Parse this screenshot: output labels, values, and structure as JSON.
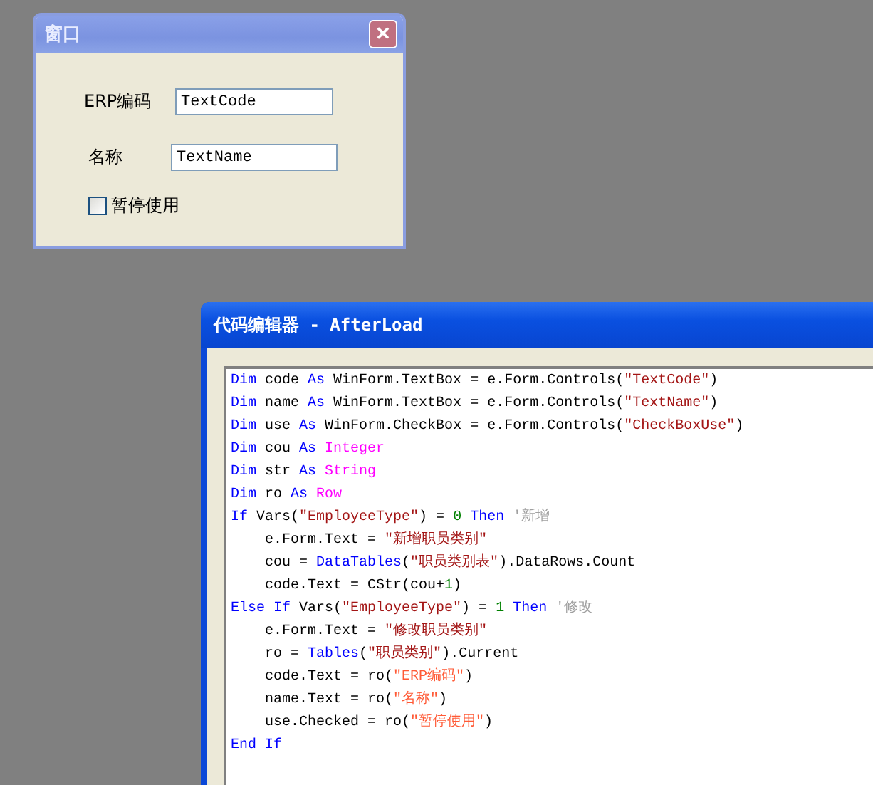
{
  "dialog": {
    "title": "窗口",
    "close": "✕",
    "fields": [
      {
        "label": "ERP编码",
        "value": "TextCode"
      },
      {
        "label": "名称",
        "value": "TextName"
      }
    ],
    "checkbox": {
      "label": "暂停使用",
      "checked": false
    }
  },
  "editor": {
    "title": "代码编辑器 - AfterLoad",
    "lines": [
      {
        "tokens": [
          {
            "kind": "keyword",
            "text": "Dim"
          },
          {
            "kind": "plain",
            "text": " code "
          },
          {
            "kind": "keyword",
            "text": "As"
          },
          {
            "kind": "plain",
            "text": " WinForm.TextBox = e.Form.Controls("
          },
          {
            "kind": "string",
            "text": "\"TextCode\""
          },
          {
            "kind": "plain",
            "text": ")"
          }
        ]
      },
      {
        "tokens": [
          {
            "kind": "keyword",
            "text": "Dim"
          },
          {
            "kind": "plain",
            "text": " name "
          },
          {
            "kind": "keyword",
            "text": "As"
          },
          {
            "kind": "plain",
            "text": " WinForm.TextBox = e.Form.Controls("
          },
          {
            "kind": "string",
            "text": "\"TextName\""
          },
          {
            "kind": "plain",
            "text": ")"
          }
        ]
      },
      {
        "tokens": [
          {
            "kind": "keyword",
            "text": "Dim"
          },
          {
            "kind": "plain",
            "text": " use "
          },
          {
            "kind": "keyword",
            "text": "As"
          },
          {
            "kind": "plain",
            "text": " WinForm.CheckBox = e.Form.Controls("
          },
          {
            "kind": "string",
            "text": "\"CheckBoxUse\""
          },
          {
            "kind": "plain",
            "text": ")"
          }
        ]
      },
      {
        "tokens": [
          {
            "kind": "keyword",
            "text": "Dim"
          },
          {
            "kind": "plain",
            "text": " cou "
          },
          {
            "kind": "keyword",
            "text": "As"
          },
          {
            "kind": "type",
            "text": " Integer"
          }
        ]
      },
      {
        "tokens": [
          {
            "kind": "keyword",
            "text": "Dim"
          },
          {
            "kind": "plain",
            "text": " str "
          },
          {
            "kind": "keyword",
            "text": "As"
          },
          {
            "kind": "type",
            "text": " String"
          }
        ]
      },
      {
        "tokens": [
          {
            "kind": "keyword",
            "text": "Dim"
          },
          {
            "kind": "plain",
            "text": " ro "
          },
          {
            "kind": "keyword",
            "text": "As"
          },
          {
            "kind": "type",
            "text": " Row"
          }
        ]
      },
      {
        "tokens": [
          {
            "kind": "keyword",
            "text": "If"
          },
          {
            "kind": "plain",
            "text": " Vars("
          },
          {
            "kind": "string",
            "text": "\"EmployeeType\""
          },
          {
            "kind": "plain",
            "text": ") = "
          },
          {
            "kind": "number",
            "text": "0"
          },
          {
            "kind": "keyword",
            "text": " Then"
          },
          {
            "kind": "comment",
            "text": " '新增"
          }
        ],
        "children": [
          {
            "tokens": [
              {
                "kind": "plain",
                "text": "e.Form.Text = "
              },
              {
                "kind": "string",
                "text": "\"新增职员类别\""
              }
            ]
          },
          {
            "tokens": [
              {
                "kind": "plain",
                "text": "cou = "
              },
              {
                "kind": "keyword",
                "text": "DataTables"
              },
              {
                "kind": "plain",
                "text": "("
              },
              {
                "kind": "string",
                "text": "\"职员类别表\""
              },
              {
                "kind": "plain",
                "text": ").DataRows.Count"
              }
            ]
          },
          {
            "tokens": [
              {
                "kind": "plain",
                "text": "code.Text = CStr(cou+"
              },
              {
                "kind": "number",
                "text": "1"
              },
              {
                "kind": "plain",
                "text": ")"
              }
            ]
          }
        ]
      },
      {
        "tokens": [
          {
            "kind": "keyword",
            "text": "Else If"
          },
          {
            "kind": "plain",
            "text": " Vars("
          },
          {
            "kind": "string",
            "text": "\"EmployeeType\""
          },
          {
            "kind": "plain",
            "text": ") = "
          },
          {
            "kind": "number",
            "text": "1"
          },
          {
            "kind": "keyword",
            "text": " Then"
          },
          {
            "kind": "comment",
            "text": " '修改"
          }
        ],
        "children": [
          {
            "tokens": [
              {
                "kind": "plain",
                "text": "e.Form.Text = "
              },
              {
                "kind": "string",
                "text": "\"修改职员类别\""
              }
            ]
          },
          {
            "tokens": [
              {
                "kind": "plain",
                "text": "ro = "
              },
              {
                "kind": "keyword",
                "text": "Tables"
              },
              {
                "kind": "plain",
                "text": "("
              },
              {
                "kind": "string",
                "text": "\"职员类别\""
              },
              {
                "kind": "plain",
                "text": ").Current"
              }
            ]
          },
          {
            "tokens": [
              {
                "kind": "plain",
                "text": "code.Text = ro("
              },
              {
                "kind": "field",
                "text": "\"ERP编码\""
              },
              {
                "kind": "plain",
                "text": ")"
              }
            ]
          },
          {
            "tokens": [
              {
                "kind": "plain",
                "text": "name.Text = ro("
              },
              {
                "kind": "field",
                "text": "\"名称\""
              },
              {
                "kind": "plain",
                "text": ")"
              }
            ]
          },
          {
            "tokens": [
              {
                "kind": "plain",
                "text": "use.Checked = ro("
              },
              {
                "kind": "field",
                "text": "\"暂停使用\""
              },
              {
                "kind": "plain",
                "text": ")"
              }
            ]
          }
        ]
      },
      {
        "tokens": [
          {
            "kind": "keyword",
            "text": "End If"
          }
        ]
      }
    ]
  }
}
